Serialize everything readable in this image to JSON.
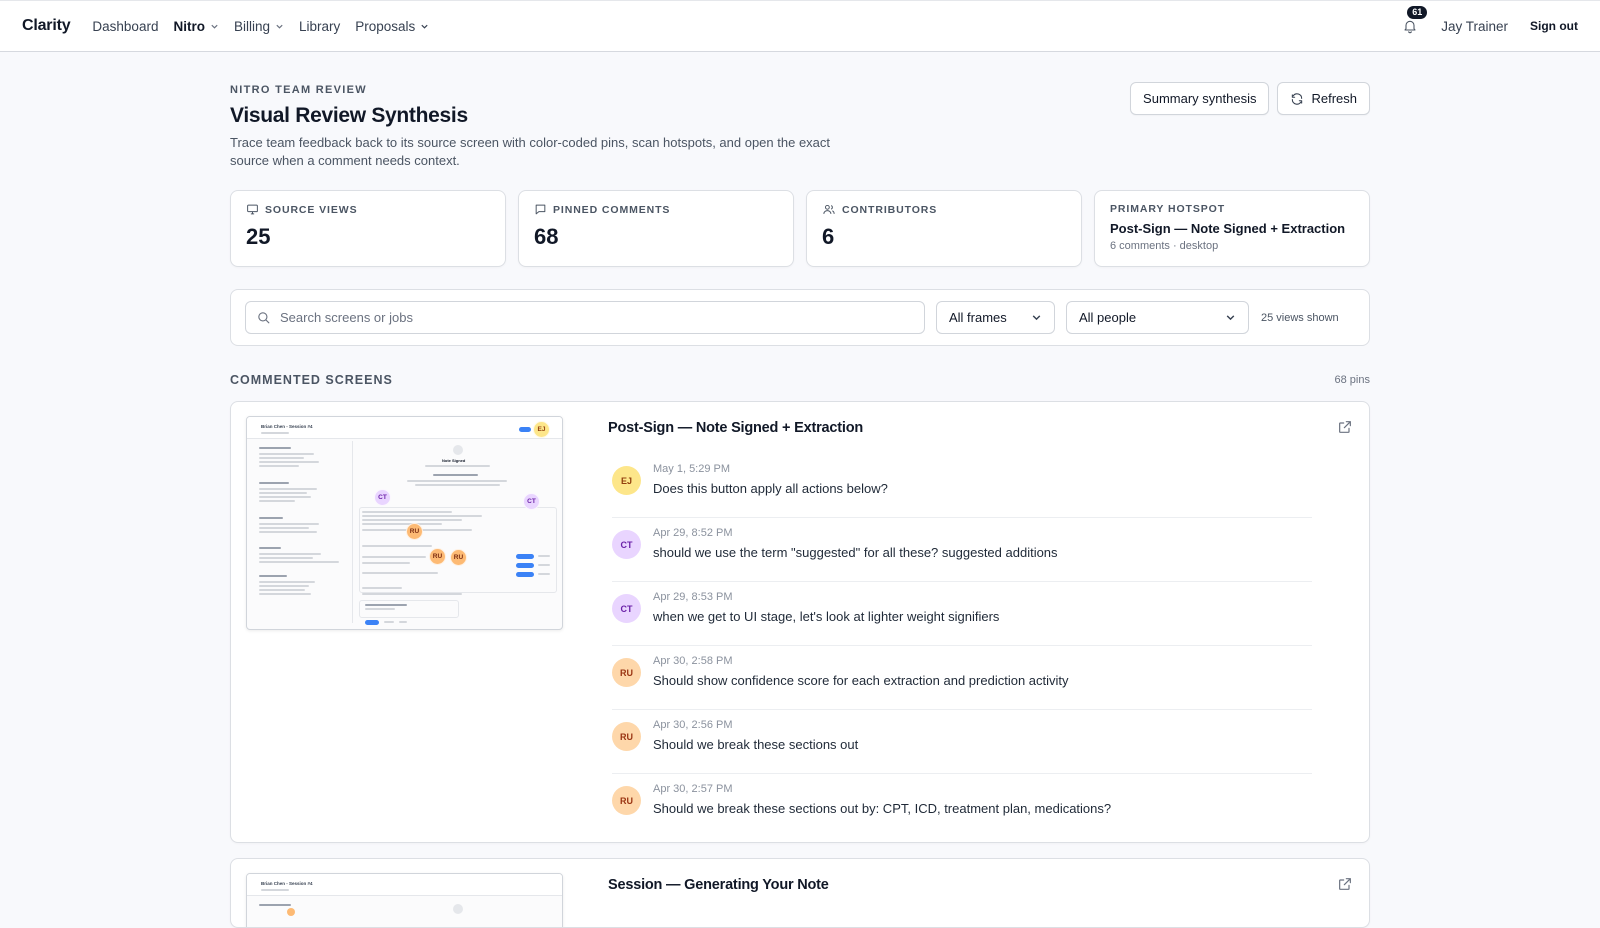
{
  "app": {
    "brand": "Clarity",
    "nav": [
      {
        "label": "Dashboard",
        "dropdown": false
      },
      {
        "label": "Nitro",
        "dropdown": true,
        "active": true
      },
      {
        "label": "Billing",
        "dropdown": true
      },
      {
        "label": "Library",
        "dropdown": false
      },
      {
        "label": "Proposals",
        "dropdown": true
      }
    ],
    "notifications_count": "61",
    "user_name": "Jay Trainer",
    "sign_out": "Sign out"
  },
  "header": {
    "eyebrow": "NITRO TEAM REVIEW",
    "title": "Visual Review Synthesis",
    "description": "Trace team feedback back to its source screen with color-coded pins, scan hotspots, and open the exact source when a comment needs context.",
    "summary_button": "Summary synthesis",
    "refresh_button": "Refresh"
  },
  "stats": {
    "source_views": {
      "label": "SOURCE VIEWS",
      "value": "25"
    },
    "pinned_comments": {
      "label": "PINNED COMMENTS",
      "value": "68"
    },
    "contributors": {
      "label": "CONTRIBUTORS",
      "value": "6"
    },
    "primary_hotspot": {
      "label": "PRIMARY HOTSPOT",
      "title": "Post-Sign — Note Signed + Extraction",
      "sub": "6 comments · desktop"
    }
  },
  "filters": {
    "search_placeholder": "Search screens or jobs",
    "frames": "All frames",
    "people": "All people",
    "views_shown": "25 views shown"
  },
  "section": {
    "title": "COMMENTED SCREENS",
    "pins": "68 pins"
  },
  "colors": {
    "EJ": {
      "bg": "#fde68a",
      "fg": "#92400e"
    },
    "CT": {
      "bg": "#e9d5ff",
      "fg": "#6b21a8"
    },
    "RU": {
      "bg": "#fed7aa",
      "fg": "#9a3412"
    }
  },
  "screens": [
    {
      "title": "Post-Sign — Note Signed + Extraction",
      "comments": [
        {
          "initials": "EJ",
          "time": "May 1, 5:29 PM",
          "text": "Does this button apply all actions below?"
        },
        {
          "initials": "CT",
          "time": "Apr 29, 8:52 PM",
          "text": "should we use the term \"suggested\" for all these? suggested additions"
        },
        {
          "initials": "CT",
          "time": "Apr 29, 8:53 PM",
          "text": "when we get to UI stage, let's look at lighter weight signifiers"
        },
        {
          "initials": "RU",
          "time": "Apr 30, 2:58 PM",
          "text": "Should show confidence score for each extraction and prediction activity"
        },
        {
          "initials": "RU",
          "time": "Apr 30, 2:56 PM",
          "text": "Should we break these sections out"
        },
        {
          "initials": "RU",
          "time": "Apr 30, 2:57 PM",
          "text": "Should we break these sections out by: CPT, ICD, treatment plan, medications?"
        }
      ]
    },
    {
      "title": "Session — Generating Your Note"
    }
  ],
  "thumbnail": {
    "header": "Brian Chen - Session #4",
    "note_title": "Note Signed",
    "pins": [
      "EJ",
      "CT",
      "CT",
      "RU",
      "RU",
      "RU"
    ]
  }
}
